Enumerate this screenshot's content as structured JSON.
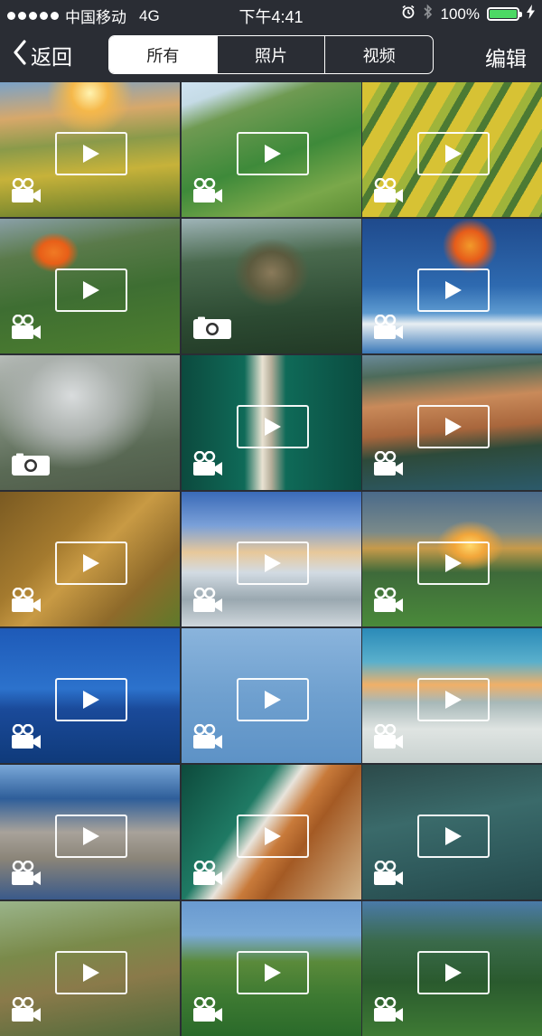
{
  "status_bar": {
    "carrier": "中国移动",
    "network": "4G",
    "time": "下午4:41",
    "battery": "100%",
    "battery_level": 1.0,
    "alarm_icon": "alarm-icon",
    "bluetooth_icon": "bluetooth-icon",
    "charging_icon": "bolt-icon"
  },
  "nav": {
    "back_label": "返回",
    "edit_label": "编辑",
    "tabs": [
      {
        "label": "所有",
        "active": true
      },
      {
        "label": "照片",
        "active": false
      },
      {
        "label": "视频",
        "active": false
      }
    ]
  },
  "colors": {
    "background": "#2a2d34",
    "battery_green": "#4cd964",
    "segment_active_bg": "#ffffff"
  },
  "media_items": [
    {
      "type": "video"
    },
    {
      "type": "video"
    },
    {
      "type": "video"
    },
    {
      "type": "video"
    },
    {
      "type": "photo"
    },
    {
      "type": "video"
    },
    {
      "type": "photo"
    },
    {
      "type": "video"
    },
    {
      "type": "video"
    },
    {
      "type": "video"
    },
    {
      "type": "video"
    },
    {
      "type": "video"
    },
    {
      "type": "video"
    },
    {
      "type": "video"
    },
    {
      "type": "video"
    },
    {
      "type": "video"
    },
    {
      "type": "video"
    },
    {
      "type": "video"
    },
    {
      "type": "video"
    },
    {
      "type": "video"
    },
    {
      "type": "video"
    }
  ]
}
